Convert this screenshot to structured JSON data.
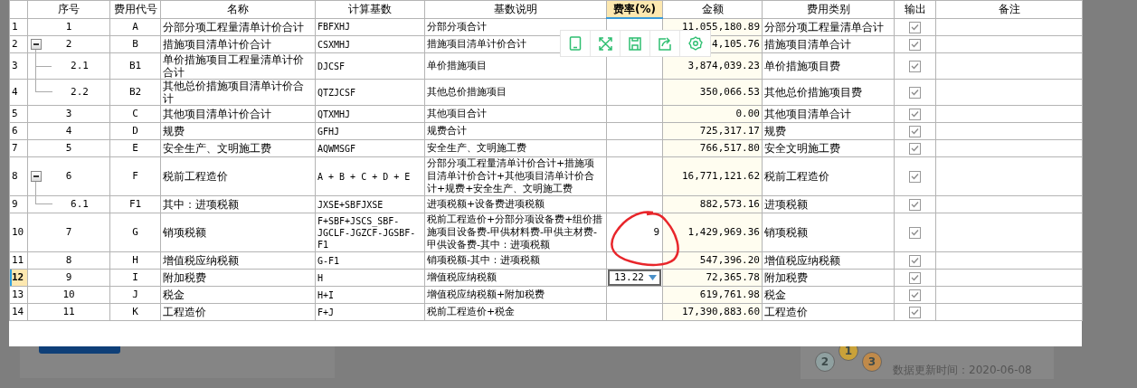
{
  "table": {
    "columns": [
      {
        "label": "序号",
        "selected": false
      },
      {
        "label": "费用代号",
        "selected": false
      },
      {
        "label": "名称",
        "selected": false
      },
      {
        "label": "计算基数",
        "selected": false
      },
      {
        "label": "基数说明",
        "selected": false
      },
      {
        "label": "费率(%)",
        "selected": true
      },
      {
        "label": "金额",
        "selected": false
      },
      {
        "label": "费用类别",
        "selected": false
      },
      {
        "label": "输出",
        "selected": false
      },
      {
        "label": "备注",
        "selected": false
      }
    ],
    "rows": [
      {
        "row_no": "1",
        "seq": "1",
        "code": "A",
        "name": "分部分项工程量清单计价合计",
        "base": "FBFXHJ",
        "desc": "分部分项合计",
        "amount": "11,055,180.89",
        "category": "分部分项工程量清单合计",
        "output": true,
        "selected": false
      },
      {
        "row_no": "2",
        "seq": "2",
        "code": "B",
        "name": "措施项目清单计价合计",
        "base": "CSXMHJ",
        "desc": "措施项目清单计价合计",
        "amount": "4,105.76",
        "category": "措施项目清单合计",
        "output": true,
        "selected": false,
        "expanded": true,
        "children": [
          {
            "row_no": "3",
            "seq": "2.1",
            "code": "B1",
            "name": "单价措施项目工程量清单计价合计",
            "base": "DJCSF",
            "desc": "单价措施项目",
            "amount": "3,874,039.23",
            "category": "单价措施项目费",
            "output": true,
            "selected": false
          },
          {
            "row_no": "4",
            "seq": "2.2",
            "code": "B2",
            "name": "其他总价措施项目清单计价合计",
            "base": "QTZJCSF",
            "desc": "其他总价措施项目",
            "amount": "350,066.53",
            "category": "其他总价措施项目费",
            "output": true,
            "selected": false
          }
        ]
      },
      {
        "row_no": "5",
        "seq": "3",
        "code": "C",
        "name": "其他项目清单计价合计",
        "base": "QTXMHJ",
        "desc": "其他项目合计",
        "amount": "0.00",
        "category": "其他项目清单合计",
        "output": true,
        "selected": false
      },
      {
        "row_no": "6",
        "seq": "4",
        "code": "D",
        "name": "规费",
        "base": "GFHJ",
        "desc": "规费合计",
        "amount": "725,317.17",
        "category": "规费",
        "output": true,
        "selected": false
      },
      {
        "row_no": "7",
        "seq": "5",
        "code": "E",
        "name": "安全生产、文明施工费",
        "base": "AQWMSGF",
        "desc": "安全生产、文明施工费",
        "amount": "766,517.80",
        "category": "安全文明施工费",
        "output": true,
        "selected": false
      },
      {
        "row_no": "8",
        "seq": "6",
        "code": "F",
        "name": "税前工程造价",
        "base": "A + B + C + D + E",
        "desc": "分部分项工程量清单计价合计+措施项目清单计价合计+其他项目清单计价合计+规费+安全生产、文明施工费",
        "amount": "16,771,121.62",
        "category": "税前工程造价",
        "output": true,
        "selected": false,
        "expanded": true,
        "children": [
          {
            "row_no": "9",
            "seq": "6.1",
            "code": "F1",
            "name": "其中：进项税额",
            "base": "JXSE+SBFJXSE",
            "desc": "进项税额+设备费进项税额",
            "amount": "882,573.16",
            "category": "进项税额",
            "output": true,
            "selected": false
          }
        ]
      },
      {
        "row_no": "10",
        "seq": "7",
        "code": "G",
        "name": "销项税额",
        "base": "F+SBF+JSCS_SBF-JGCLF-JGZCF-JGSBF-F1",
        "desc": "税前工程造价+分部分项设备费+组价措施项目设备费-甲供材料费-甲供主材费-甲供设备费-其中：进项税额",
        "rate": "9",
        "amount": "1,429,969.36",
        "category": "销项税额",
        "output": true,
        "selected": false
      },
      {
        "row_no": "11",
        "seq": "8",
        "code": "H",
        "name": "增值税应纳税额",
        "base": "G-F1",
        "desc": "销项税额-其中：进项税额",
        "amount": "547,396.20",
        "category": "增值税应纳税额",
        "output": true,
        "selected": false
      },
      {
        "row_no": "12",
        "seq": "9",
        "code": "I",
        "name": "附加税费",
        "base": "H",
        "desc": "增值税应纳税额",
        "rate": "13.22",
        "editing": true,
        "amount": "72,365.78",
        "category": "附加税费",
        "output": true,
        "selected": true
      },
      {
        "row_no": "13",
        "seq": "10",
        "code": "J",
        "name": "税金",
        "base": "H+I",
        "desc": "增值税应纳税额+附加税费",
        "amount": "619,761.98",
        "category": "税金",
        "output": true,
        "selected": false
      },
      {
        "row_no": "14",
        "seq": "11",
        "code": "K",
        "name": "工程造价",
        "base": "F+J",
        "desc": "税前工程造价+税金",
        "amount": "17,390,883.60",
        "category": "工程造价",
        "output": true,
        "selected": false
      }
    ]
  },
  "toolbar": [
    {
      "kind": "tablet"
    },
    {
      "kind": "expand"
    },
    {
      "kind": "save"
    },
    {
      "kind": "share"
    },
    {
      "kind": "settings"
    }
  ],
  "background": {
    "medals": [
      {
        "label": "2",
        "color": "#8fa0a0"
      },
      {
        "label": "1",
        "color": "#c9a23a"
      },
      {
        "label": "3",
        "color": "#c08a4a"
      }
    ],
    "update_time": "数据更新时间：2020-06-08"
  }
}
